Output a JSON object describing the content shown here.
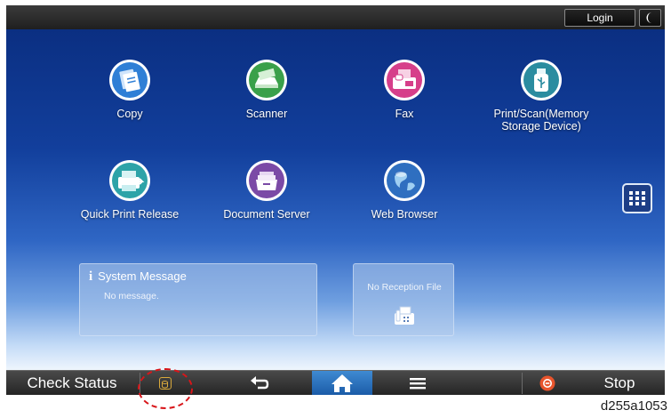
{
  "header": {
    "login_label": "Login",
    "mode_icon": "moon-icon"
  },
  "apps": [
    {
      "label": "Copy",
      "icon": "copy-icon",
      "color": "#2f7fd6"
    },
    {
      "label": "Scanner",
      "icon": "scanner-icon",
      "color": "#3aa04a"
    },
    {
      "label": "Fax",
      "icon": "fax-icon",
      "color": "#d63f8a"
    },
    {
      "label": "Print/Scan(Memory\nStorage Device)",
      "icon": "usb-icon",
      "color": "#2b8ca0"
    },
    {
      "label": "Quick Print Release",
      "icon": "quick-print-icon",
      "color": "#2da3a8"
    },
    {
      "label": "Document Server",
      "icon": "document-server-icon",
      "color": "#7b4aa6"
    },
    {
      "label": "Web Browser",
      "icon": "globe-icon",
      "color": "#2f6fc0"
    }
  ],
  "widgets": {
    "system_message": {
      "title": "System Message",
      "text": "No message."
    },
    "reception": {
      "text": "No Reception File"
    }
  },
  "footer": {
    "check_status_label": "Check Status",
    "stop_label": "Stop",
    "home_active_color": "#2f7fd0",
    "stop_color": "#e8542c"
  },
  "figure_code": "d255a1053"
}
